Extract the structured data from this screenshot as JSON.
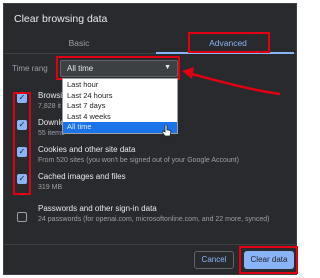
{
  "dialog": {
    "title": "Clear browsing data"
  },
  "tabs": [
    {
      "label": "Basic",
      "active": false
    },
    {
      "label": "Advanced",
      "active": true
    }
  ],
  "time_range": {
    "label": "Time rang",
    "selected": "All time",
    "options": [
      "Last hour",
      "Last 24 hours",
      "Last 7 days",
      "Last 4 weeks",
      "All time"
    ]
  },
  "items": [
    {
      "title": "Browsin",
      "subtitle": "7,828 it",
      "checked": true
    },
    {
      "title": "Downlo",
      "subtitle": "55 items",
      "checked": true
    },
    {
      "title": "Cookies and other site data",
      "subtitle": "From 520 sites (you won't be signed out of your Google Account)",
      "checked": true
    },
    {
      "title": "Cached images and files",
      "subtitle": "319 MB",
      "checked": true
    },
    {
      "title": "Passwords and other sign-in data",
      "subtitle": "24 passwords (for openai.com, microsoftonline.com, and 22 more, synced)",
      "checked": false
    }
  ],
  "buttons": {
    "cancel": "Cancel",
    "clear": "Clear data"
  },
  "colors": {
    "dialog_bg": "#292a2d",
    "accent": "#8ab4f8",
    "highlight_box": "#e00012",
    "dropdown_selected": "#1a73e8"
  },
  "icons": {
    "caret": "caret-down-icon",
    "checkbox": "checkmark-icon",
    "pointer": "mouse-cursor-icon",
    "annotation_arrow": "red-arrow-icon"
  }
}
